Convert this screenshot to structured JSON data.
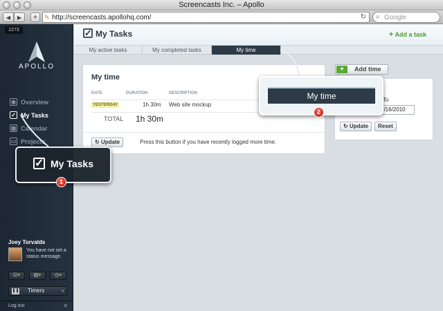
{
  "window": {
    "title": "Screencasts Inc. – Apollo",
    "url": "http://screencasts.apollohq.com/",
    "search_placeholder": "Google"
  },
  "sidebar": {
    "counter": "2273",
    "logo": "APOLLO",
    "items": [
      {
        "label": "Overview",
        "icon": "eye-icon"
      },
      {
        "label": "My Tasks",
        "icon": "checkbox-icon"
      },
      {
        "label": "Calendar",
        "icon": "calendar-icon"
      },
      {
        "label": "Projects",
        "icon": "folder-icon"
      }
    ],
    "user": {
      "name": "Joey Torvalds",
      "status": "You have not set a status message."
    },
    "timers_label": "Timers",
    "logout_label": "Log out"
  },
  "header": {
    "title": "My Tasks",
    "add_task_label": "Add a task"
  },
  "tabs": [
    {
      "label": "My active tasks",
      "active": false
    },
    {
      "label": "My completed tasks",
      "active": false
    },
    {
      "label": "My time",
      "active": true
    }
  ],
  "time_panel": {
    "title": "My time",
    "columns": [
      "DATE",
      "DURATION",
      "DESCRIPTION"
    ],
    "rows": [
      {
        "date": "YESTERDAY",
        "duration": "1h 30m",
        "description": "Web site mockup"
      }
    ],
    "total_label": "TOTAL",
    "total_value": "1h 30m",
    "update_label": "Update",
    "update_hint": "Press this button if you have recently logged more time."
  },
  "side_panel": {
    "add_time_label": "Add time",
    "to_label": "To",
    "to_date": "6/16/2010",
    "update_label": "Update",
    "reset_label": "Reset"
  },
  "callouts": {
    "one": {
      "label": "My Tasks",
      "number": "1"
    },
    "two": {
      "label": "My time",
      "number": "2"
    }
  },
  "colors": {
    "accent_green": "#5aa832",
    "sidebar": "#1f2a35",
    "badge_red": "#d6281b"
  }
}
